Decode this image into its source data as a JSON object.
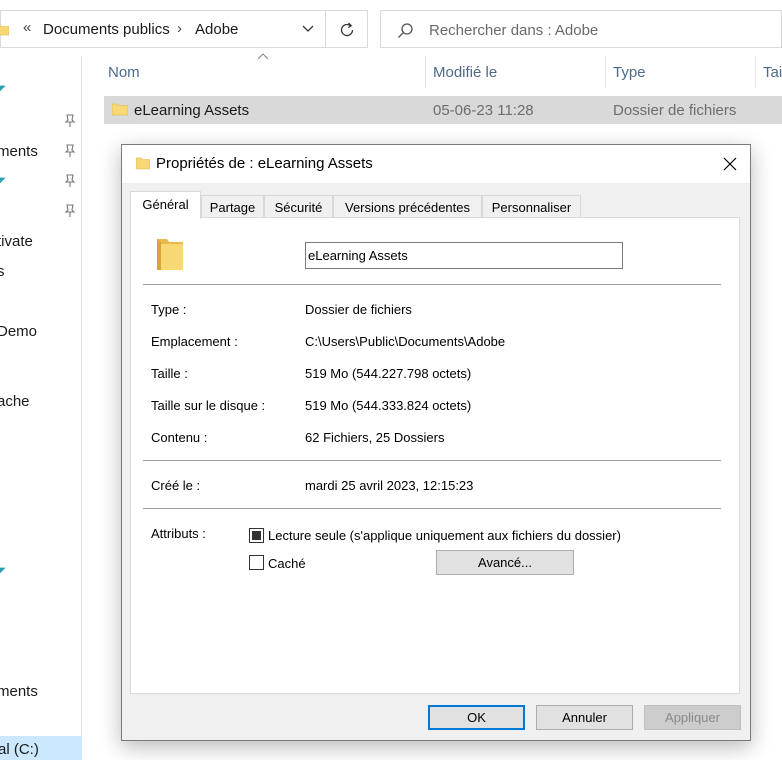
{
  "explorer": {
    "address": {
      "overflow_glyph": "«",
      "crumbs": [
        "Documents publics",
        "Adobe"
      ],
      "separator": "›"
    },
    "search": {
      "placeholder": "Rechercher dans : Adobe"
    },
    "nav_items": [
      "ments",
      "tivate",
      "s",
      " Demo",
      "ache",
      "ments"
    ],
    "drive_label": "al (C:)",
    "columns": {
      "name": "Nom",
      "modified": "Modifié le",
      "type": "Type",
      "size": "Tai"
    },
    "rows": [
      {
        "name": "eLearning Assets",
        "modified": "05-06-23 11:28",
        "type": "Dossier de fichiers"
      }
    ]
  },
  "dialog": {
    "title": "Propriétés de : eLearning Assets",
    "tabs": [
      "Général",
      "Partage",
      "Sécurité",
      "Versions précédentes",
      "Personnaliser"
    ],
    "active_tab": 0,
    "folder_name": "eLearning Assets",
    "properties": [
      {
        "label": "Type :",
        "value": "Dossier de fichiers"
      },
      {
        "label": "Emplacement :",
        "value": "C:\\Users\\Public\\Documents\\Adobe"
      },
      {
        "label": "Taille :",
        "value": "519 Mo (544.227.798 octets)"
      },
      {
        "label": "Taille sur le disque :",
        "value": "519 Mo (544.333.824 octets)"
      },
      {
        "label": "Contenu :",
        "value": "62 Fichiers, 25 Dossiers"
      }
    ],
    "created": {
      "label": "Créé le :",
      "value": "mardi 25 avril 2023, 12:15:23"
    },
    "attributes": {
      "label": "Attributs :",
      "readonly": {
        "label": "Lecture seule (s'applique uniquement aux fichiers du dossier)",
        "state": "indeterminate"
      },
      "hidden": {
        "label": "Caché",
        "checked": false
      },
      "advanced_label": "Avancé..."
    },
    "buttons": {
      "ok": "OK",
      "cancel": "Annuler",
      "apply": "Appliquer"
    }
  },
  "colors": {
    "accent": "#0078d7",
    "selection": "#d9d9d9",
    "folder": "#f8d775",
    "header_text": "#4d6a8a"
  },
  "icons": [
    "folder-icon",
    "chevron-down-icon",
    "refresh-icon",
    "search-icon",
    "pin-icon",
    "close-icon"
  ]
}
